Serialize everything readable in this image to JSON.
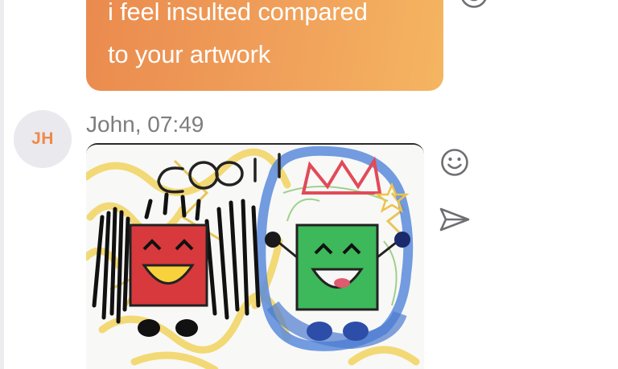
{
  "previous_message": {
    "lines": [
      "i feel insulted compared",
      "to your artwork"
    ]
  },
  "message": {
    "avatar_initials": "JH",
    "sender_line": "John, 07:49"
  },
  "icons": {
    "emoji": "smiley-icon",
    "send": "send-icon",
    "image": "drawing-image"
  },
  "colors": {
    "bubble_start": "#ea8a4e",
    "bubble_end": "#f5b561",
    "avatar_text": "#ee8a48",
    "avatar_bg": "#e9e9ee",
    "timestamp_text": "#7d7d80",
    "icon": "#6e6e73"
  }
}
